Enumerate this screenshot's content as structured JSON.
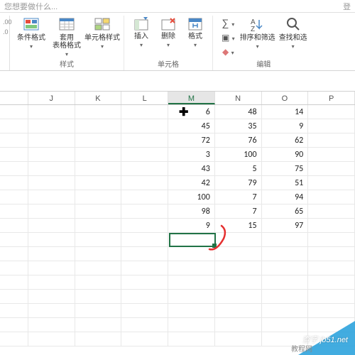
{
  "topbar": {
    "hint": "您想要做什么...",
    "login": "登"
  },
  "ribbon": {
    "styles": {
      "group_label": "样式",
      "cond_format": "条件格式",
      "table_format": "套用\n表格格式",
      "cell_styles": "单元格样式"
    },
    "cells": {
      "group_label": "单元格",
      "insert": "插入",
      "delete": "删除",
      "format": "格式"
    },
    "editing": {
      "group_label": "编辑",
      "sort_filter": "排序和筛选",
      "find_select": "查找和选"
    }
  },
  "columns": [
    "J",
    "K",
    "L",
    "M",
    "N",
    "O",
    "P"
  ],
  "selected_column": "M",
  "grid": {
    "rows": [
      {
        "M": "6",
        "N": "48",
        "O": "14"
      },
      {
        "M": "45",
        "N": "35",
        "O": "9"
      },
      {
        "M": "72",
        "N": "76",
        "O": "62"
      },
      {
        "M": "3",
        "N": "100",
        "O": "90"
      },
      {
        "M": "43",
        "N": "5",
        "O": "75"
      },
      {
        "M": "42",
        "N": "79",
        "O": "51"
      },
      {
        "M": "100",
        "N": "7",
        "O": "94"
      },
      {
        "M": "98",
        "N": "7",
        "O": "65"
      },
      {
        "M": "9",
        "N": "15",
        "O": "97"
      }
    ],
    "empty_rows": 8
  },
  "selection": {
    "col": "M",
    "row_after_data": true
  },
  "watermark": {
    "text1": "查字",
    "domain": "jb51.net",
    "text2": "教程网"
  }
}
